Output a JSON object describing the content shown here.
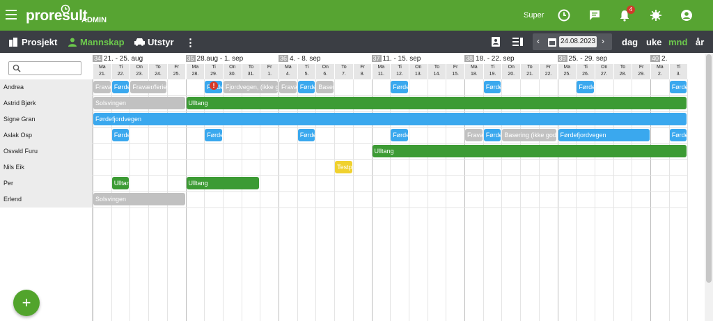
{
  "app": {
    "logo": "proresult",
    "admin_label": "ADMIN",
    "user": "Super",
    "notification_count": "4"
  },
  "nav": {
    "prosjekt": "Prosjekt",
    "mannskap": "Mannskap",
    "utstyr": "Utstyr",
    "more": "⋮"
  },
  "date": {
    "value": "24.08.2023",
    "prev": "‹",
    "next": "›"
  },
  "views": {
    "dag": "dag",
    "uke": "uke",
    "mnd": "mnd",
    "ar": "år"
  },
  "weeks": [
    {
      "num": "34",
      "label": "21. - 25. aug"
    },
    {
      "num": "35",
      "label": "28.aug - 1. sep"
    },
    {
      "num": "36",
      "label": "4. - 8. sep"
    },
    {
      "num": "37",
      "label": "11. - 15. sep"
    },
    {
      "num": "38",
      "label": "18. - 22. sep"
    },
    {
      "num": "39",
      "label": "25. - 29. sep"
    },
    {
      "num": "40",
      "label": "2."
    }
  ],
  "days": [
    [
      "Ma",
      "21."
    ],
    [
      "Ti",
      "22."
    ],
    [
      "On",
      "23."
    ],
    [
      "To",
      "24."
    ],
    [
      "Fr",
      "25."
    ],
    [
      "Ma",
      "28."
    ],
    [
      "Ti",
      "29."
    ],
    [
      "On",
      "30."
    ],
    [
      "To",
      "31."
    ],
    [
      "Fr",
      "1."
    ],
    [
      "Ma",
      "4."
    ],
    [
      "Ti",
      "5."
    ],
    [
      "On",
      "6."
    ],
    [
      "To",
      "7."
    ],
    [
      "Fr",
      "8."
    ],
    [
      "Ma",
      "11."
    ],
    [
      "Ti",
      "12."
    ],
    [
      "On",
      "13."
    ],
    [
      "To",
      "14."
    ],
    [
      "Fr",
      "15."
    ],
    [
      "Ma",
      "18."
    ],
    [
      "Ti",
      "19."
    ],
    [
      "On",
      "20."
    ],
    [
      "To",
      "21."
    ],
    [
      "Fr",
      "22."
    ],
    [
      "Ma",
      "25."
    ],
    [
      "Ti",
      "26."
    ],
    [
      "On",
      "27."
    ],
    [
      "To",
      "28."
    ],
    [
      "Fr",
      "29."
    ],
    [
      "Ma",
      "2."
    ],
    [
      "Ti",
      "3."
    ]
  ],
  "people": [
    "Andrea",
    "Astrid Bjørk",
    "Signe Gran",
    "Aslak Osp",
    "Osvald Furu",
    "Nils Eik",
    "Per",
    "Erlend"
  ],
  "assignments": [
    {
      "row": 0,
      "start": 0,
      "days": 1,
      "color": "grey",
      "label": "Fravær/ferie"
    },
    {
      "row": 0,
      "start": 1,
      "days": 1,
      "color": "blue",
      "label": "Førdefjordvegen"
    },
    {
      "row": 0,
      "start": 2,
      "days": 2,
      "color": "grey",
      "label": "Fravær/ferie"
    },
    {
      "row": 0,
      "start": 6,
      "days": 1,
      "color": "blue",
      "label": "Førdefjordvegen"
    },
    {
      "row": 0,
      "start": 7,
      "days": 3,
      "color": "grey",
      "label": "Fjordvegen, (ikke godkjent)"
    },
    {
      "row": 0,
      "start": 10,
      "days": 1,
      "color": "grey",
      "label": "Fravær/ferie"
    },
    {
      "row": 0,
      "start": 11,
      "days": 1,
      "color": "blue",
      "label": "Førdefjordvegen"
    },
    {
      "row": 0,
      "start": 12,
      "days": 1,
      "color": "grey",
      "label": "Basering"
    },
    {
      "row": 0,
      "start": 16,
      "days": 1,
      "color": "blue",
      "label": "Førdefjordvegen"
    },
    {
      "row": 0,
      "start": 21,
      "days": 1,
      "color": "blue",
      "label": "Førdefjordvegen"
    },
    {
      "row": 0,
      "start": 26,
      "days": 1,
      "color": "blue",
      "label": "Førdefjordvegen"
    },
    {
      "row": 0,
      "start": 31,
      "days": 1,
      "color": "blue",
      "label": "Førdefjordvegen"
    },
    {
      "row": 1,
      "start": 0,
      "days": 5,
      "color": "grey",
      "label": "Solsvingen"
    },
    {
      "row": 1,
      "start": 5,
      "days": 27,
      "color": "green",
      "label": "Ulltang"
    },
    {
      "row": 2,
      "start": 0,
      "days": 32,
      "color": "blue",
      "label": "Førdefjordvegen"
    },
    {
      "row": 3,
      "start": 1,
      "days": 1,
      "color": "blue",
      "label": "Førdefjordvegen"
    },
    {
      "row": 3,
      "start": 6,
      "days": 1,
      "color": "blue",
      "label": "Førdefjordvegen"
    },
    {
      "row": 3,
      "start": 11,
      "days": 1,
      "color": "blue",
      "label": "Førdefjordvegen"
    },
    {
      "row": 3,
      "start": 16,
      "days": 1,
      "color": "blue",
      "label": "Førdefjordvegen"
    },
    {
      "row": 3,
      "start": 20,
      "days": 1,
      "color": "grey",
      "label": "Fravær/ferie"
    },
    {
      "row": 3,
      "start": 21,
      "days": 1,
      "color": "blue",
      "label": "Førdefjordvegen"
    },
    {
      "row": 3,
      "start": 22,
      "days": 3,
      "color": "grey",
      "label": "Basering (ikke godkjent)"
    },
    {
      "row": 3,
      "start": 25,
      "days": 5,
      "color": "blue",
      "label": "Førdefjordvegen"
    },
    {
      "row": 3,
      "start": 31,
      "days": 1,
      "color": "blue",
      "label": "Førdefjordvegen"
    },
    {
      "row": 4,
      "start": 15,
      "days": 17,
      "color": "green",
      "label": "Ulltang"
    },
    {
      "row": 5,
      "start": 13,
      "days": 1,
      "color": "yellow",
      "label": "Testprosjekt"
    },
    {
      "row": 6,
      "start": 1,
      "days": 1,
      "color": "green",
      "label": "Ulltang"
    },
    {
      "row": 6,
      "start": 5,
      "days": 4,
      "color": "green",
      "label": "Ulltang"
    },
    {
      "row": 7,
      "start": 0,
      "days": 5,
      "color": "grey",
      "label": "Solsvingen"
    }
  ],
  "warning": "!",
  "fab": "+"
}
